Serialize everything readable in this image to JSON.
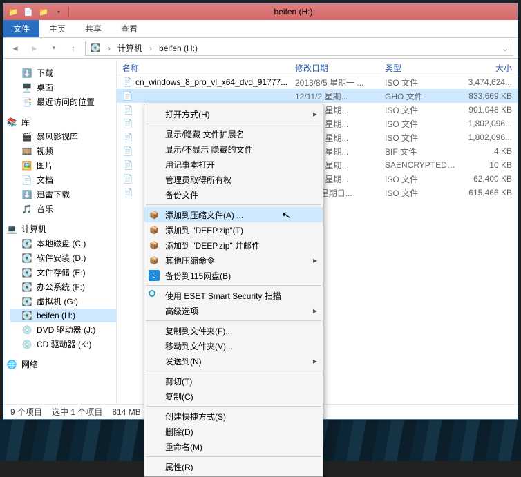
{
  "window": {
    "title": "beifen (H:)"
  },
  "ribbon": {
    "file": "文件",
    "home": "主页",
    "share": "共享",
    "view": "查看"
  },
  "breadcrumb": {
    "crumb1": "计算机",
    "crumb2": "beifen (H:)"
  },
  "sidebar": {
    "downloads": "下载",
    "desktop": "桌面",
    "recent": "最近访问的位置",
    "libraries": "库",
    "baofeng": "暴风影视库",
    "video": "视频",
    "pictures": "图片",
    "documents": "文档",
    "xunlei": "迅雷下载",
    "music": "音乐",
    "computer": "计算机",
    "driveC": "本地磁盘 (C:)",
    "driveD": "软件安装 (D:)",
    "driveE": "文件存储 (E:)",
    "driveF": "办公系统 (F:)",
    "driveG": "虚拟机 (G:)",
    "driveH": "beifen (H:)",
    "driveJ": "DVD 驱动器 (J:)",
    "driveK": "CD 驱动器 (K:)",
    "network": "网络"
  },
  "columns": {
    "name": "名称",
    "date": "修改日期",
    "type": "类型",
    "size": "大小"
  },
  "rows": [
    {
      "name": "cn_windows_8_pro_vl_x64_dvd_91777...",
      "date": "2013/8/5 星期一 ...",
      "type": "ISO 文件",
      "size": "3,474,624..."
    },
    {
      "name": "",
      "date": "12/11/2 星期...",
      "type": "GHO 文件",
      "size": "833,669 KB",
      "selected": true
    },
    {
      "name": "",
      "date": "13/8/12 星期...",
      "type": "ISO 文件",
      "size": "901,048 KB"
    },
    {
      "name": "",
      "date": "13/8/12 星期...",
      "type": "ISO 文件",
      "size": "1,802,096..."
    },
    {
      "name": "",
      "date": "13/8/12 星期...",
      "type": "ISO 文件",
      "size": "1,802,096..."
    },
    {
      "name": "",
      "date": "13/8/13 星期...",
      "type": "BIF 文件",
      "size": "4 KB"
    },
    {
      "name": "",
      "date": "13/8/12 星期...",
      "type": "SAENCRYPTEDR...",
      "size": "10 KB"
    },
    {
      "name": "",
      "date": "12/6/19 星期...",
      "type": "ISO 文件",
      "size": "62,400 KB"
    },
    {
      "name": "",
      "date": "13/8/4 星期日...",
      "type": "ISO 文件",
      "size": "615,466 KB"
    }
  ],
  "status": {
    "count": "9 个项目",
    "selected": "选中 1 个项目",
    "size": "814 MB"
  },
  "context": {
    "open_with": "打开方式(H)",
    "show_hide_ext": "显示/隐藏 文件扩展名",
    "show_hide_hidden": "显示/不显示 隐藏的文件",
    "notepad": "用记事本打开",
    "take_owner": "管理员取得所有权",
    "backup": "备份文件",
    "add_archive": "添加到压缩文件(A) ...",
    "add_deep": "添加到 \"DEEP.zip\"(T)",
    "add_deep_mail": "添加到 \"DEEP.zip\" 并邮件",
    "other_compress": "其他压缩命令",
    "backup115": "备份到115网盘(B)",
    "eset": "使用 ESET Smart Security 扫描",
    "eset_adv": "高级选项",
    "copy_to": "复制到文件夹(F)...",
    "move_to": "移动到文件夹(V)...",
    "send_to": "发送到(N)",
    "cut": "剪切(T)",
    "copy": "复制(C)",
    "create_shortcut": "创建快捷方式(S)",
    "delete": "删除(D)",
    "rename": "重命名(M)",
    "properties": "属性(R)"
  }
}
